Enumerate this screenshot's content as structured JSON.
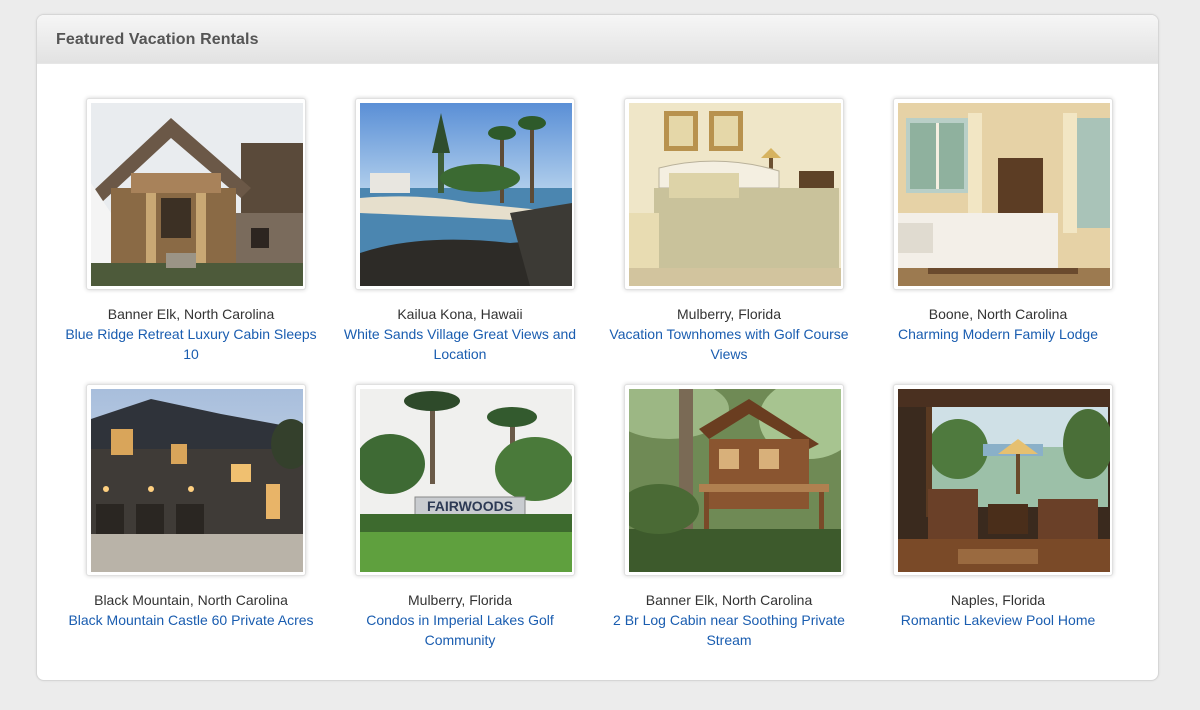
{
  "section": {
    "title": "Featured Vacation Rentals"
  },
  "listings": [
    {
      "location": "Banner Elk, North Carolina",
      "title": "Blue Ridge Retreat Luxury Cabin Sleeps 10"
    },
    {
      "location": "Kailua Kona, Hawaii",
      "title": "White Sands Village Great Views and Location"
    },
    {
      "location": "Mulberry, Florida",
      "title": "Vacation Townhomes with Golf Course Views"
    },
    {
      "location": "Boone, North Carolina",
      "title": "Charming Modern Family Lodge"
    },
    {
      "location": "Black Mountain, North Carolina",
      "title": "Black Mountain Castle 60 Private Acres"
    },
    {
      "location": "Mulberry, Florida",
      "title": "Condos in Imperial Lakes Golf Community"
    },
    {
      "location": "Banner Elk, North Carolina",
      "title": "2 Br Log Cabin near Soothing Private Stream"
    },
    {
      "location": "Naples, Florida",
      "title": "Romantic Lakeview Pool Home"
    }
  ],
  "sign_text": "FAIRWOODS",
  "colors": {
    "link": "#1a5db0",
    "text": "#333333",
    "header_text": "#555555",
    "page_bg": "#ececec"
  }
}
